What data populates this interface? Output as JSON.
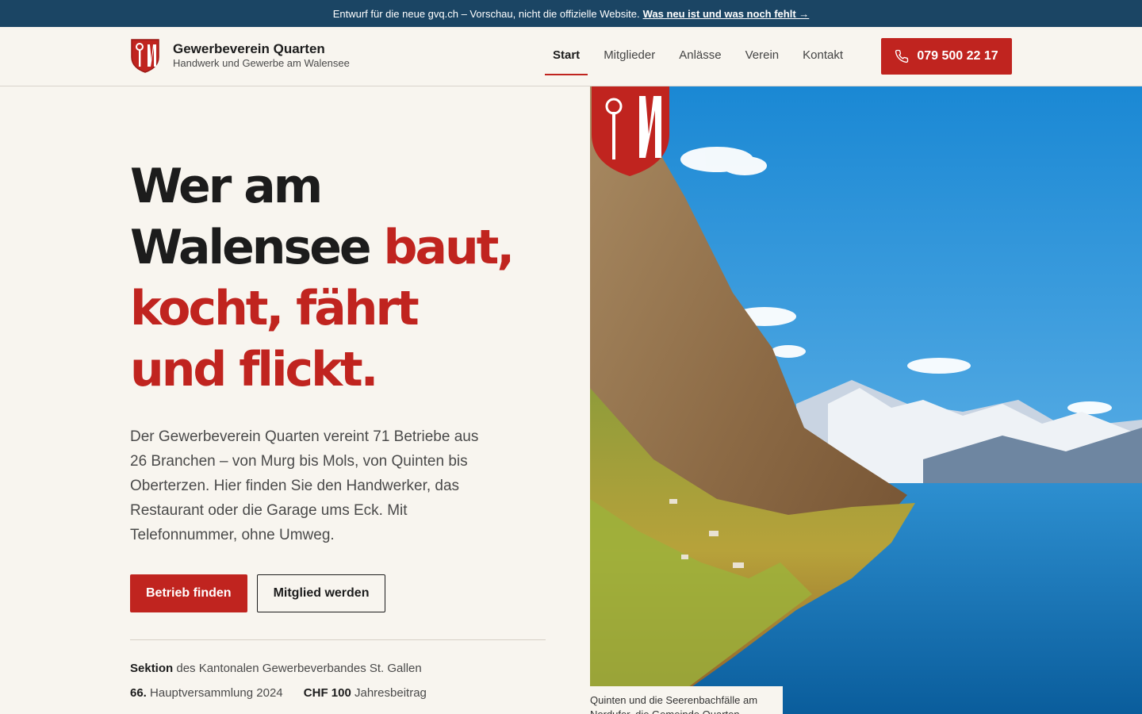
{
  "announcement": {
    "text": "Entwurf für die neue gvq.ch – Vorschau, nicht die offizielle Website.",
    "link": "Was neu ist und was noch fehlt →"
  },
  "header": {
    "brand_name": "Gewerbeverein Quarten",
    "brand_tagline": "Handwerk und Gewerbe am Walensee",
    "nav": [
      "Start",
      "Mitglieder",
      "Anlässe",
      "Verein",
      "Kontakt"
    ],
    "active_nav": "Start",
    "phone": "079 500 22 17"
  },
  "hero": {
    "headline_dark": "Wer am Walensee",
    "headline_red_1": "baut,",
    "headline_red_2": "kocht, fährt",
    "headline_red_3": "und flickt.",
    "lead": "Der Gewerbeverein Quarten vereint 71 Betriebe aus 26 Branchen – von Murg bis Mols, von Quinten bis Oberterzen. Hier finden Sie den Handwerker, das Restaurant oder die Garage ums Eck. Mit Telefonnummer, ohne Umweg.",
    "cta_primary": "Betrieb finden",
    "cta_secondary": "Mitglied werden"
  },
  "facts": {
    "sektion_label": "Sektion",
    "sektion_text": "des Kantonalen Gewerbeverbandes St. Gallen",
    "hv_number": "66.",
    "hv_text": "Hauptversammlung 2024",
    "fee_value": "CHF 100",
    "fee_text": "Jahresbeitrag"
  },
  "image": {
    "caption_line1": "Quinten und die Seerenbachfälle am",
    "caption_line2": "Nordufer, die Gemeinde Quarten"
  },
  "colors": {
    "accent": "#c0241f",
    "banner": "#1b4564",
    "background": "#f8f5ef"
  }
}
